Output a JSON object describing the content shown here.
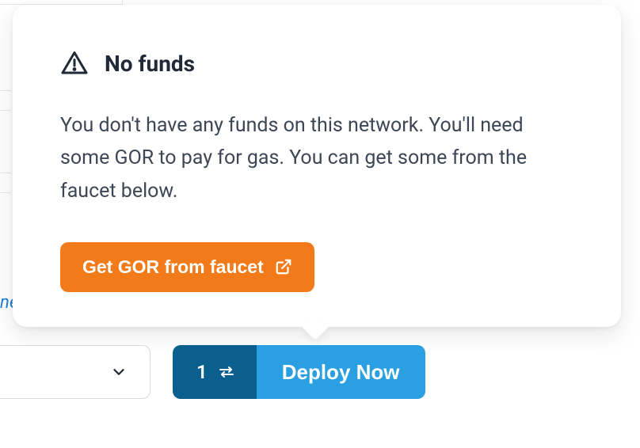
{
  "background": {
    "link_fragment": "ne"
  },
  "popover": {
    "title": "No funds",
    "body": "You don't have any funds on this network. You'll need some GOR to pay for gas. You can get some from the faucet below.",
    "faucet_button_label": "Get GOR from faucet"
  },
  "controls": {
    "tx_count": "1",
    "deploy_label": "Deploy Now"
  }
}
